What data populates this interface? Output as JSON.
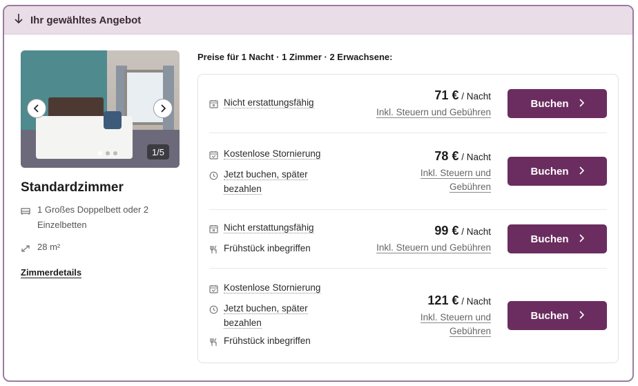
{
  "header": {
    "title": "Ihr gewähltes Angebot"
  },
  "room": {
    "name": "Standardzimmer",
    "bed": "1 Großes Doppelbett oder 2 Einzelbetten",
    "size": "28 m²",
    "details_link": "Zimmerdetails",
    "photo_counter": "1/5"
  },
  "offers": {
    "heading": "Preise für 1 Nacht · 1 Zimmer · 2 Erwachsene:",
    "items": [
      {
        "features": [
          {
            "icon": "calendar-x-icon",
            "text": "Nicht erstattungsfähig",
            "underline": true
          }
        ],
        "price": "71 €",
        "per": "/ Nacht",
        "tax_lines": [
          "Inkl. Steuern und Gebühren"
        ],
        "button": "Buchen"
      },
      {
        "features": [
          {
            "icon": "calendar-check-icon",
            "text": "Kostenlose Stornierung",
            "underline": true
          },
          {
            "icon": "clock-icon",
            "text_lines": [
              "Jetzt buchen, später",
              "bezahlen"
            ],
            "underline": true
          }
        ],
        "price": "78 €",
        "per": "/ Nacht",
        "tax_lines": [
          "Inkl. Steuern und",
          "Gebühren"
        ],
        "button": "Buchen"
      },
      {
        "features": [
          {
            "icon": "calendar-x-icon",
            "text": "Nicht erstattungsfähig",
            "underline": true
          },
          {
            "icon": "cutlery-icon",
            "text": "Frühstück inbegriffen",
            "underline": false
          }
        ],
        "price": "99 €",
        "per": "/ Nacht",
        "tax_lines": [
          "Inkl. Steuern und Gebühren"
        ],
        "button": "Buchen"
      },
      {
        "features": [
          {
            "icon": "calendar-check-icon",
            "text": "Kostenlose Stornierung",
            "underline": true
          },
          {
            "icon": "clock-icon",
            "text_lines": [
              "Jetzt buchen, später",
              "bezahlen"
            ],
            "underline": true
          },
          {
            "icon": "cutlery-icon",
            "text": "Frühstück inbegriffen",
            "underline": false
          }
        ],
        "price": "121 €",
        "per": "/ Nacht",
        "tax_lines": [
          "Inkl. Steuern und",
          "Gebühren"
        ],
        "button": "Buchen"
      }
    ]
  },
  "colors": {
    "accent": "#6b2d5f",
    "header_bg": "#e9dde7",
    "border": "#9b7aa0"
  }
}
